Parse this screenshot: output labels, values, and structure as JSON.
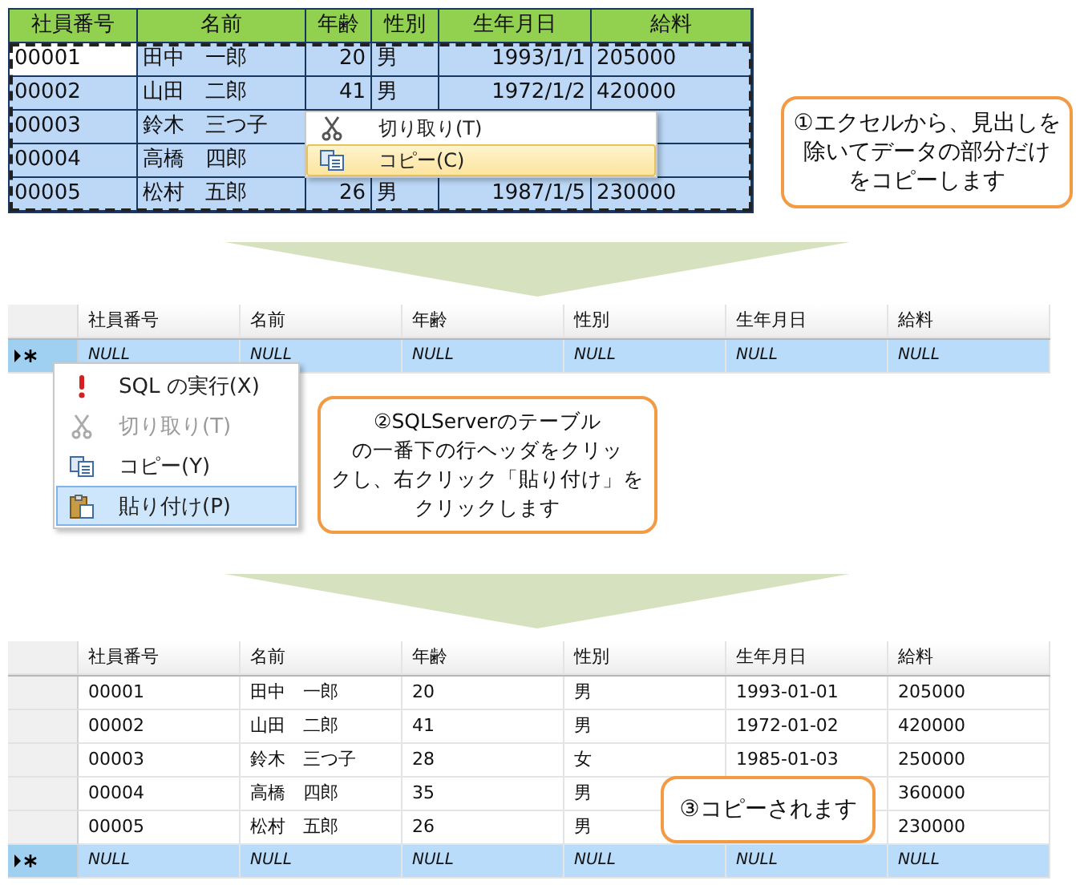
{
  "excel_sheet": {
    "columns": [
      "社員番号",
      "名前",
      "年齢",
      "性別",
      "生年月日",
      "給料"
    ],
    "rows": [
      {
        "active": true,
        "cells": [
          "00001",
          "田中　一郎",
          "20",
          "男",
          "1993/1/1",
          "205000"
        ]
      },
      {
        "active": false,
        "cells": [
          "00002",
          "山田　二郎",
          "41",
          "男",
          "1972/1/2",
          "420000"
        ]
      },
      {
        "active": false,
        "cells": [
          "00003",
          "鈴木　三つ子",
          null,
          null,
          null,
          null
        ]
      },
      {
        "active": false,
        "cells": [
          "00004",
          "高橋　四郎",
          null,
          null,
          null,
          null
        ]
      },
      {
        "active": false,
        "cells": [
          "00005",
          "松村　五郎",
          "26",
          "男",
          "1987/1/5",
          "230000"
        ]
      }
    ]
  },
  "excel_menu": {
    "items": [
      {
        "kind": "cut",
        "label": "切り取り(T)",
        "selected": false,
        "disabled": false
      },
      {
        "kind": "copy",
        "label": "コピー(C)",
        "selected": true,
        "disabled": false
      }
    ]
  },
  "callout_1": {
    "lines": [
      "①エクセルから、見出しを",
      "除いてデータの部分だけ",
      "をコピーします"
    ]
  },
  "sql_grid_before": {
    "columns": [
      "社員番号",
      "名前",
      "年齢",
      "性別",
      "生年月日",
      "給料"
    ],
    "rows": [
      {
        "new_row": true,
        "selected": true,
        "cells": [
          "NULL",
          "NULL",
          "NULL",
          "NULL",
          "NULL",
          "NULL"
        ]
      }
    ]
  },
  "sql_menu": {
    "items": [
      {
        "kind": "run",
        "label": "SQL の実行(X)",
        "selected": false,
        "disabled": false
      },
      {
        "kind": "cut",
        "label": "切り取り(T)",
        "selected": false,
        "disabled": true
      },
      {
        "kind": "copy",
        "label": "コピー(Y)",
        "selected": false,
        "disabled": false
      },
      {
        "kind": "paste",
        "label": "貼り付け(P)",
        "selected": true,
        "disabled": false
      }
    ]
  },
  "callout_2": {
    "lines": [
      "②SQLServerのテーブル",
      "の一番下の行ヘッダをクリッ",
      "クし、右クリック「貼り付け」を",
      "クリックします"
    ]
  },
  "sql_grid_after": {
    "columns": [
      "社員番号",
      "名前",
      "年齢",
      "性別",
      "生年月日",
      "給料"
    ],
    "rows": [
      {
        "new_row": false,
        "selected": false,
        "cells": [
          "00001",
          "田中　一郎",
          "20",
          "男",
          "1993-01-01",
          "205000"
        ]
      },
      {
        "new_row": false,
        "selected": false,
        "cells": [
          "00002",
          "山田　二郎",
          "41",
          "男",
          "1972-01-02",
          "420000"
        ]
      },
      {
        "new_row": false,
        "selected": false,
        "cells": [
          "00003",
          "鈴木　三つ子",
          "28",
          "女",
          "1985-01-03",
          "250000"
        ]
      },
      {
        "new_row": false,
        "selected": false,
        "cells": [
          "00004",
          "高橋　四郎",
          "35",
          "男",
          null,
          "360000"
        ]
      },
      {
        "new_row": false,
        "selected": false,
        "cells": [
          "00005",
          "松村　五郎",
          "26",
          "男",
          null,
          "230000"
        ]
      },
      {
        "new_row": true,
        "selected": true,
        "cells": [
          "NULL",
          "NULL",
          "NULL",
          "NULL",
          "NULL",
          "NULL"
        ]
      }
    ]
  },
  "callout_3": {
    "lines": [
      "③コピーされます"
    ]
  }
}
